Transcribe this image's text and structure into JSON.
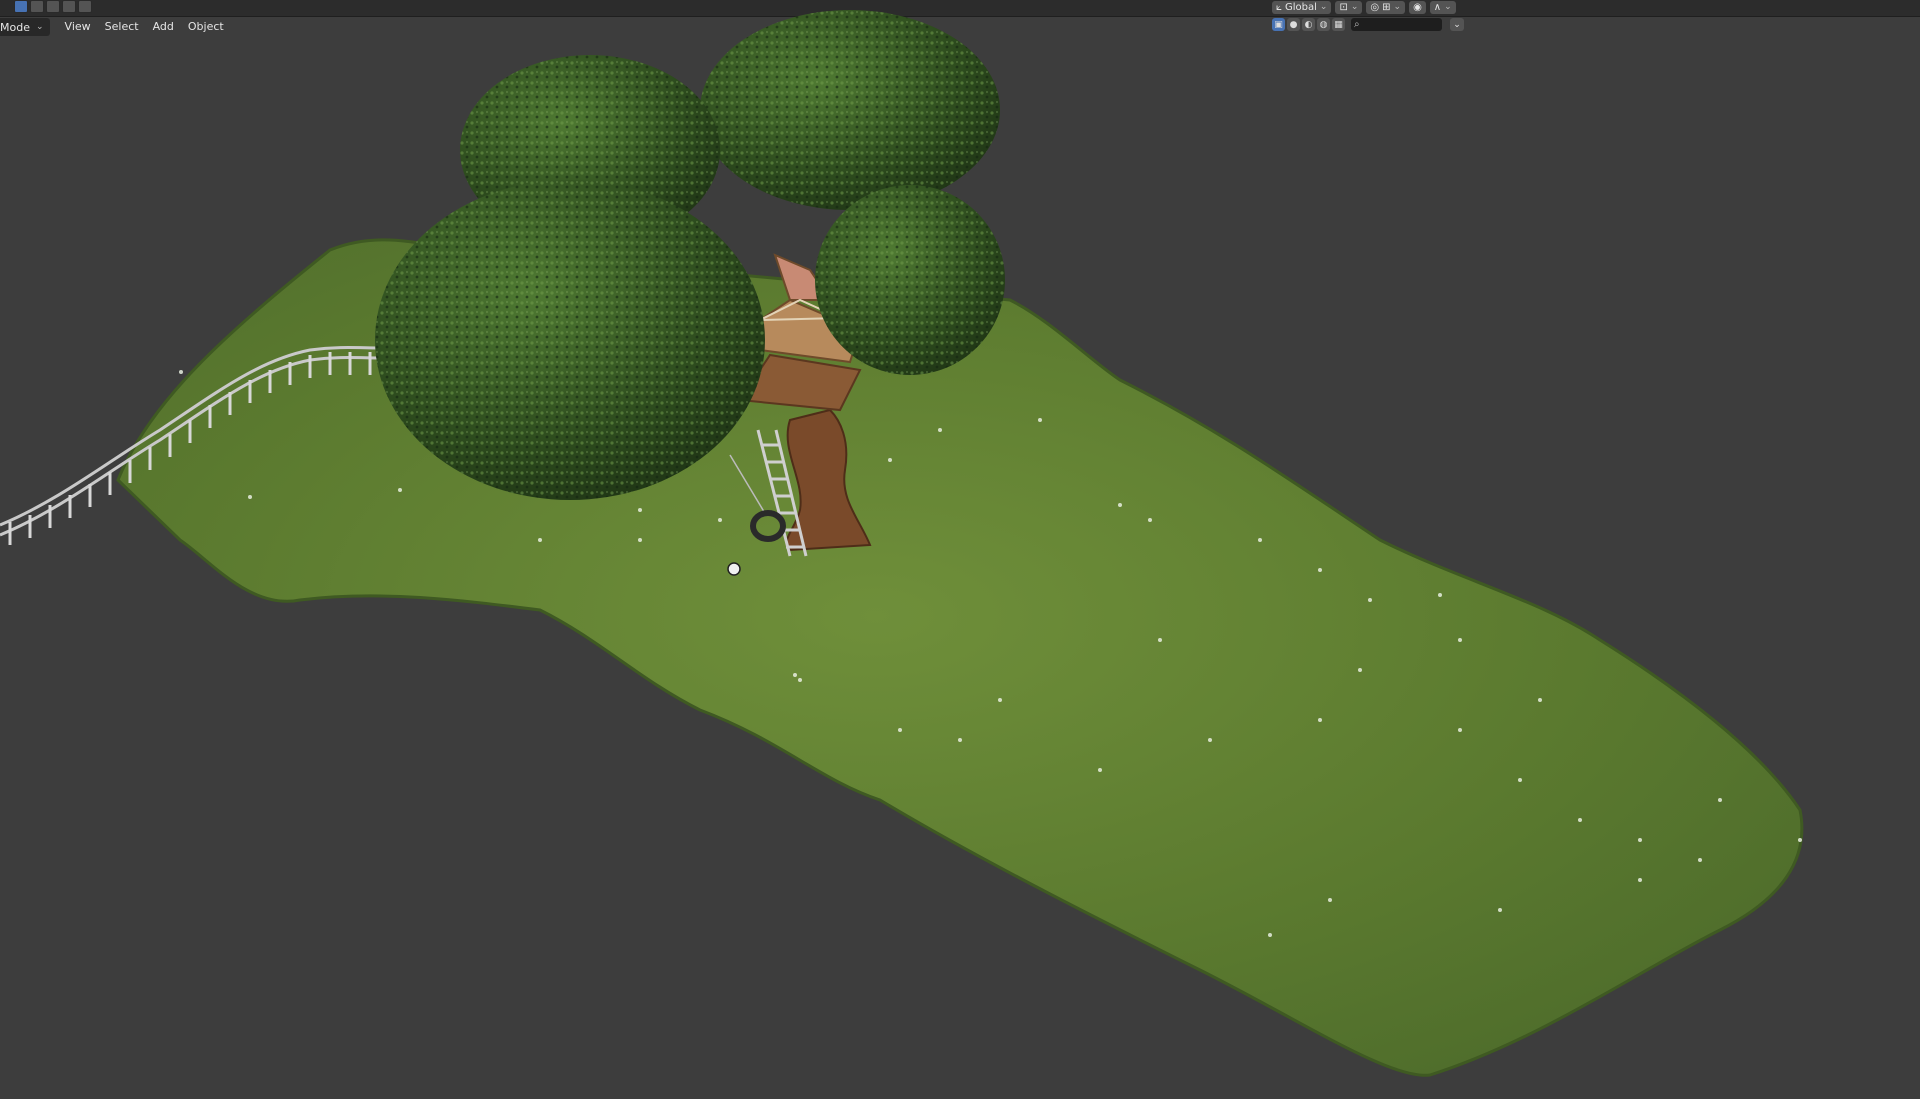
{
  "header": {
    "mode_label": "Mode",
    "menu": [
      "View",
      "Select",
      "Add",
      "Object"
    ]
  },
  "transform": {
    "orientation_label": "Global"
  },
  "colors": {
    "viewport_bg": "#3d3d3d",
    "header_bg": "#2c2c2c",
    "accent": "#4772b3",
    "grass_dark": "#4d6b2b",
    "grass_light": "#6f8f3a",
    "foliage_dark": "#1f3515",
    "foliage_light": "#4f7a32",
    "trunk": "#7a4a2a",
    "house": "#b78a5c"
  },
  "icons": {
    "select_modes": [
      "select-box-icon",
      "select-extend-icon",
      "select-subtract-icon",
      "select-invert-icon",
      "select-intersect-icon"
    ],
    "shading": [
      "wireframe-icon",
      "solid-icon",
      "material-icon",
      "rendered-icon",
      "overlay-icon"
    ],
    "search": "search-icon",
    "collapse": "chevron-down-icon"
  }
}
